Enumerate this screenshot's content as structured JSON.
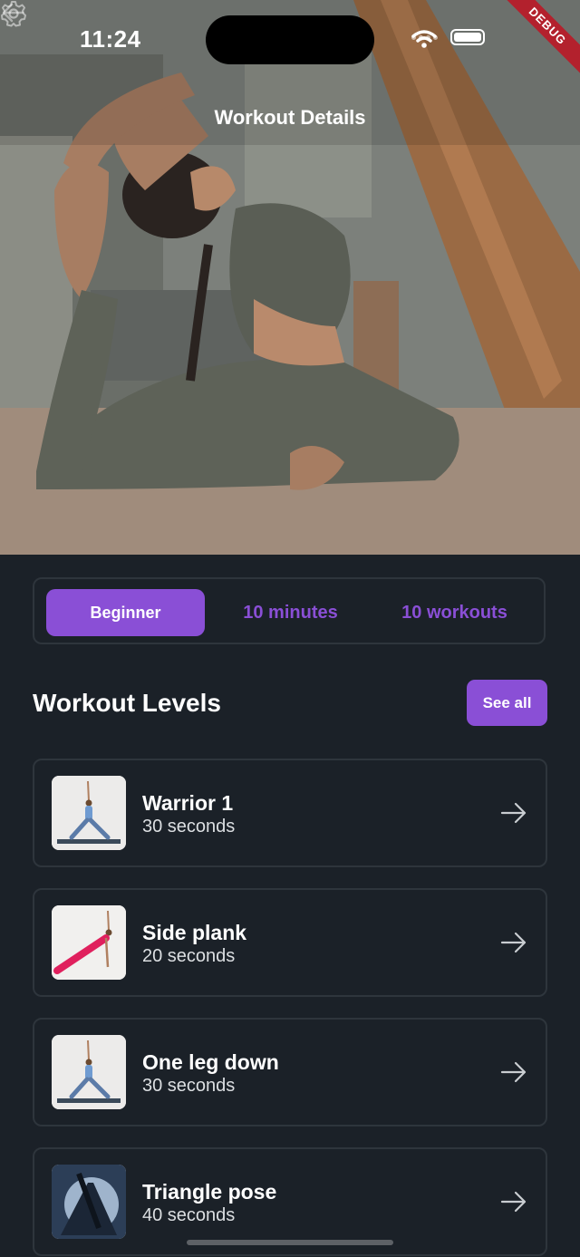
{
  "status_bar": {
    "time": "11:24",
    "debug_label": "DEBUG"
  },
  "app_bar": {
    "title": "Workout Details",
    "back_icon": "arrow-left-icon",
    "settings_icon": "gear-icon"
  },
  "segment": {
    "items": [
      "Beginner",
      "10 minutes",
      "10 workouts"
    ],
    "active_index": 0
  },
  "section": {
    "title": "Workout Levels",
    "see_all_label": "See all"
  },
  "workouts": [
    {
      "name": "Warrior 1",
      "duration": "30 seconds",
      "thumb": "warrior-pose"
    },
    {
      "name": "Side plank",
      "duration": "20 seconds",
      "thumb": "side-plank-pose"
    },
    {
      "name": "One leg down",
      "duration": "30 seconds",
      "thumb": "warrior-pose"
    },
    {
      "name": "Triangle pose",
      "duration": "40 seconds",
      "thumb": "silhouette-pose"
    }
  ],
  "colors": {
    "background": "#1b2128",
    "accent": "#8a4fd6",
    "card_border": "#2e353c",
    "debug_banner": "#b3212d"
  }
}
